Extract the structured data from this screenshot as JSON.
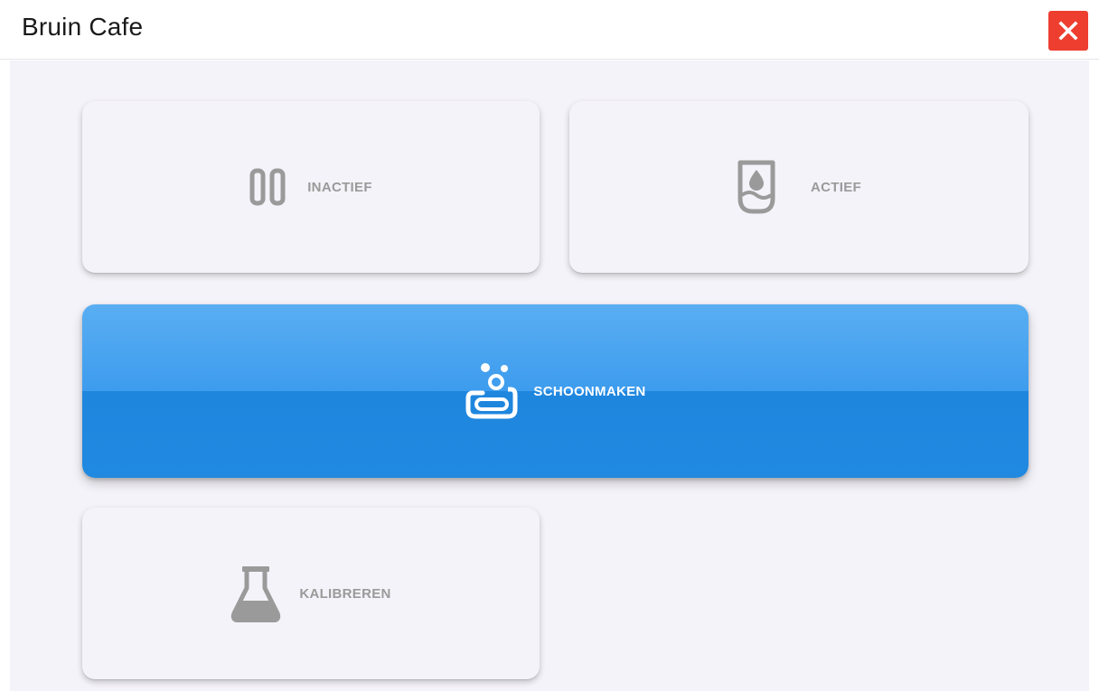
{
  "header": {
    "title": "Bruin Cafe",
    "close_icon": "close-icon",
    "close_color": "#ee3e30"
  },
  "tiles": [
    {
      "label": "INACTIEF",
      "icon": "pause-icon",
      "active": false
    },
    {
      "label": "ACTIEF",
      "icon": "glass-drop-icon",
      "active": false
    },
    {
      "label": "SCHOONMAKEN",
      "icon": "soap-bubbles-icon",
      "active": true
    },
    {
      "label": "KALIBREREN",
      "icon": "flask-icon",
      "active": false
    }
  ],
  "colors": {
    "accent": "#2089e0",
    "tile_bg": "#f4f3f9",
    "muted_text": "#9a9a9a"
  }
}
